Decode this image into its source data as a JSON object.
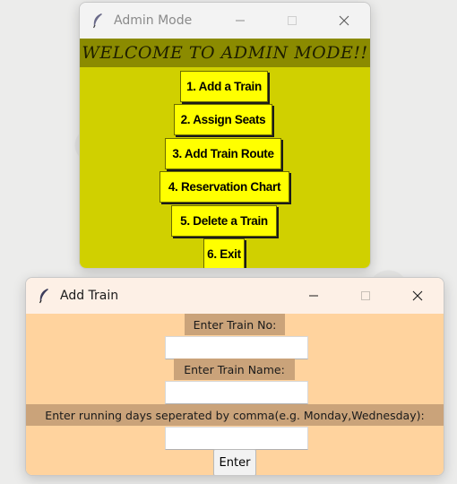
{
  "admin_window": {
    "title": "Admin Mode",
    "welcome": "WELCOME TO ADMIN MODE!!",
    "menu": [
      "1. Add a Train",
      "2. Assign Seats",
      "3. Add Train Route",
      "4. Reservation Chart",
      "5. Delete a Train",
      "6. Exit"
    ],
    "colors": {
      "background": "#d0d000",
      "banner": "#8b8b00",
      "button": "#ffff00"
    }
  },
  "add_train_window": {
    "title": "Add Train",
    "fields": [
      {
        "label": "Enter Train No:",
        "value": ""
      },
      {
        "label": "Enter Train Name:",
        "value": ""
      },
      {
        "label": "Enter running days seperated by comma(e.g. Monday,Wednesday):",
        "value": ""
      }
    ],
    "enter_label": "Enter",
    "colors": {
      "background": "#ffd39e",
      "label": "#caa37a"
    }
  },
  "icons": [
    "feather-icon",
    "minimize-icon",
    "maximize-icon",
    "close-icon"
  ]
}
